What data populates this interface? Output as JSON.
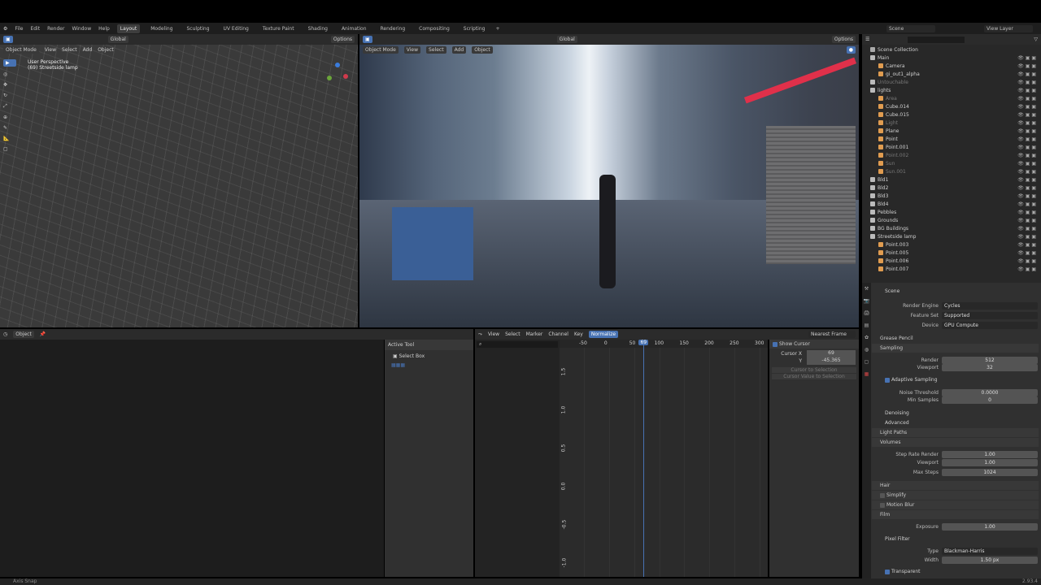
{
  "menu": [
    "File",
    "Edit",
    "Render",
    "Window",
    "Help"
  ],
  "workspaces": [
    "Layout",
    "Modeling",
    "Sculpting",
    "UV Editing",
    "Texture Paint",
    "Shading",
    "Animation",
    "Rendering",
    "Compositing",
    "Scripting"
  ],
  "active_workspace": "Layout",
  "scene": "Scene",
  "view_layer": "View Layer",
  "viewport_left": {
    "mode": "Object Mode",
    "menus": [
      "View",
      "Select",
      "Add",
      "Object"
    ],
    "orientation": "Global",
    "options": "Options",
    "overlay_title": "User Perspective",
    "overlay_sub": "(69) Streetside lamp"
  },
  "viewport_right": {
    "mode": "Object Mode",
    "menus": [
      "View",
      "Select",
      "Add",
      "Object"
    ],
    "orientation": "Global",
    "options": "Options"
  },
  "outliner": {
    "root": "Scene Collection",
    "rows": [
      {
        "name": "Main",
        "depth": 0,
        "type": "collection"
      },
      {
        "name": "Camera",
        "depth": 1,
        "type": "camera"
      },
      {
        "name": "gi_out1_alpha",
        "depth": 1,
        "type": "mesh"
      },
      {
        "name": "Untouchable",
        "depth": 0,
        "type": "collection",
        "dim": true
      },
      {
        "name": "lights",
        "depth": 0,
        "type": "collection"
      },
      {
        "name": "Area",
        "depth": 1,
        "type": "light",
        "dim": true
      },
      {
        "name": "Cube.014",
        "depth": 1,
        "type": "mesh"
      },
      {
        "name": "Cube.015",
        "depth": 1,
        "type": "mesh"
      },
      {
        "name": "Light",
        "depth": 1,
        "type": "light",
        "dim": true
      },
      {
        "name": "Plane",
        "depth": 1,
        "type": "mesh"
      },
      {
        "name": "Point",
        "depth": 1,
        "type": "light"
      },
      {
        "name": "Point.001",
        "depth": 1,
        "type": "light"
      },
      {
        "name": "Point.002",
        "depth": 1,
        "type": "light",
        "dim": true
      },
      {
        "name": "Sun",
        "depth": 1,
        "type": "light",
        "dim": true
      },
      {
        "name": "Sun.001",
        "depth": 1,
        "type": "light",
        "dim": true
      },
      {
        "name": "Bld1",
        "depth": 0,
        "type": "collection"
      },
      {
        "name": "Bld2",
        "depth": 0,
        "type": "collection"
      },
      {
        "name": "Bld3",
        "depth": 0,
        "type": "collection"
      },
      {
        "name": "Bld4",
        "depth": 0,
        "type": "collection"
      },
      {
        "name": "Pebbles",
        "depth": 0,
        "type": "collection"
      },
      {
        "name": "Grounds",
        "depth": 0,
        "type": "collection"
      },
      {
        "name": "BG Buildings",
        "depth": 0,
        "type": "collection"
      },
      {
        "name": "Streetside lamp",
        "depth": 0,
        "type": "collection"
      },
      {
        "name": "Point.003",
        "depth": 1,
        "type": "light"
      },
      {
        "name": "Point.005",
        "depth": 1,
        "type": "light"
      },
      {
        "name": "Point.006",
        "depth": 1,
        "type": "light"
      },
      {
        "name": "Point.007",
        "depth": 1,
        "type": "light"
      }
    ]
  },
  "properties": {
    "context": "Scene",
    "render_engine_label": "Render Engine",
    "render_engine": "Cycles",
    "feature_set_label": "Feature Set",
    "feature_set": "Supported",
    "device_label": "Device",
    "device": "GPU Compute",
    "grease_pencil": "Grease Pencil",
    "sampling": "Sampling",
    "render_label": "Render",
    "render_samples": "512",
    "viewport_label": "Viewport",
    "viewport_samples": "32",
    "adaptive_sampling": "Adaptive Sampling",
    "noise_threshold_label": "Noise Threshold",
    "noise_threshold": "0.0000",
    "min_samples_label": "Min Samples",
    "min_samples": "0",
    "denoising": "Denoising",
    "advanced": "Advanced",
    "light_paths": "Light Paths",
    "volumes": "Volumes",
    "step_rate_render_label": "Step Rate Render",
    "step_rate_render": "1.00",
    "step_viewport_label": "Viewport",
    "step_viewport": "1.00",
    "max_steps_label": "Max Steps",
    "max_steps": "1024",
    "hair": "Hair",
    "simplify": "Simplify",
    "motion_blur": "Motion Blur",
    "film": "Film",
    "exposure_label": "Exposure",
    "exposure": "1.00",
    "pixel_filter": "Pixel Filter",
    "type_label": "Type",
    "type": "Blackman-Harris",
    "width_label": "Width",
    "width": "1.50 px",
    "transparent": "Transparent"
  },
  "properties_editor_bottom": {
    "mode": "Object",
    "active_tool": "Active Tool",
    "tool": "Select Box"
  },
  "graph": {
    "menus": [
      "View",
      "Select",
      "Marker",
      "Channel",
      "Key"
    ],
    "normalize": "Normalize",
    "interp": "Nearest Frame",
    "x_ticks": [
      "-50",
      "0",
      "50",
      "100",
      "150",
      "200",
      "250",
      "300"
    ],
    "current_frame": "69",
    "y_ticks": [
      "1.5",
      "1.0",
      "0.5",
      "0.0",
      "-0.5",
      "-1.0"
    ],
    "show_cursor": "Show Cursor",
    "cursor_x_label": "Cursor X",
    "cursor_x": "69",
    "cursor_y_label": "Y",
    "cursor_y": "-45.365",
    "cursor_to_selection": "Cursor to Selection",
    "cursor_value_to_selection": "Cursor Value to Selection"
  },
  "status": {
    "left": "Axis Snap",
    "version": "2.93.4"
  }
}
